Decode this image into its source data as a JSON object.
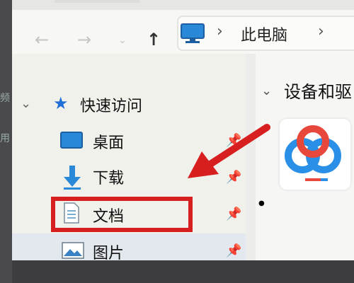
{
  "address_bar": {
    "location": "此电脑"
  },
  "quick_access": {
    "header": "快速访问",
    "items": [
      {
        "label": "桌面",
        "icon": "desktop-icon",
        "pinned": true
      },
      {
        "label": "下载",
        "icon": "download-icon",
        "pinned": true
      },
      {
        "label": "文档",
        "icon": "document-icon",
        "pinned": true,
        "highlighted": true
      },
      {
        "label": "图片",
        "icon": "pictures-icon",
        "pinned": true
      }
    ]
  },
  "content": {
    "section_header": "设备和驱"
  },
  "colors": {
    "highlight_box": "#d71f1f",
    "arrow": "#d71f1f",
    "star": "#1f6fd6"
  }
}
